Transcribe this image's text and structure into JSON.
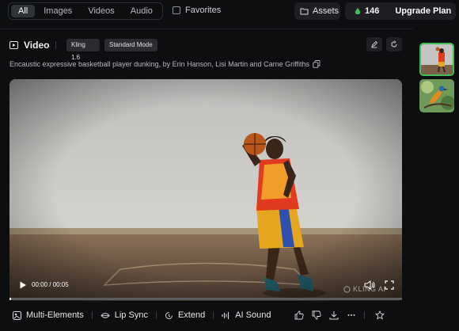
{
  "filters": {
    "tabs": [
      {
        "label": "All",
        "active": true
      },
      {
        "label": "Images",
        "active": false
      },
      {
        "label": "Videos",
        "active": false
      },
      {
        "label": "Audio",
        "active": false
      }
    ],
    "favorites_label": "Favorites"
  },
  "header": {
    "assets_label": "Assets",
    "credits": "146",
    "upgrade_label": "Upgrade Plan",
    "credit_color": "#3fbf56"
  },
  "item": {
    "section_title": "Video",
    "model_tag": "Kling 1.6",
    "mode_tag": "Standard Mode",
    "prompt": "Encaustic expressive basketball player dunking, by Erin Hanson, Lisi Martin and Carne Griffiths"
  },
  "player": {
    "time": "00:00 / 00:05",
    "progress": 0.0,
    "watermark": "KLING AI"
  },
  "toolbar": {
    "items": [
      {
        "label": "Multi-Elements",
        "icon": "multi-elements-icon"
      },
      {
        "label": "Lip Sync",
        "icon": "lip-sync-icon"
      },
      {
        "label": "Extend",
        "icon": "extend-icon"
      },
      {
        "label": "AI Sound",
        "icon": "ai-sound-icon"
      }
    ]
  },
  "colors": {
    "accent": "#3fbf56",
    "background": "#0d0e10",
    "panel": "#1d1f23"
  }
}
